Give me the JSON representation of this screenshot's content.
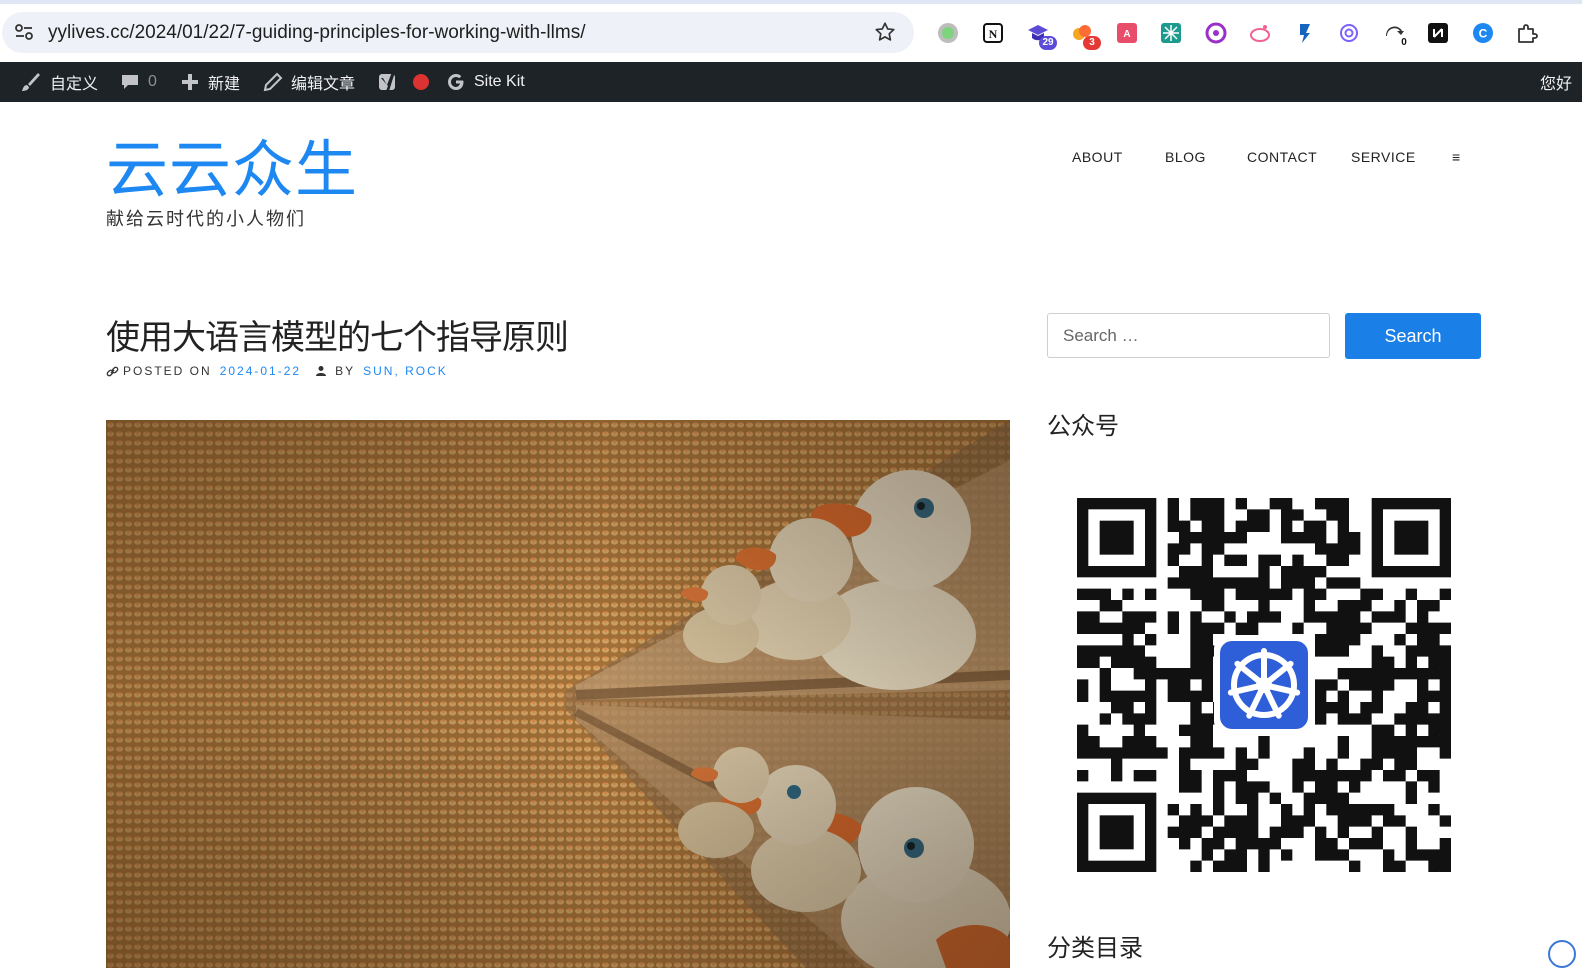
{
  "browser": {
    "url": "yylives.cc/2024/01/22/7-guiding-principles-for-working-with-llms/",
    "extensions": [
      {
        "name": "status-dot-extension",
        "badge": ""
      },
      {
        "name": "notion-extension",
        "badge": ""
      },
      {
        "name": "graduation-cap-extension",
        "badge": "29"
      },
      {
        "name": "cloud-extension",
        "badge": "3"
      },
      {
        "name": "translate-extension",
        "badge": ""
      },
      {
        "name": "grid-extension",
        "badge": ""
      },
      {
        "name": "purple-circle-extension",
        "badge": ""
      },
      {
        "name": "weibo-extension",
        "badge": ""
      },
      {
        "name": "blue-arrow-extension",
        "badge": ""
      },
      {
        "name": "openai-extension",
        "badge": ""
      },
      {
        "name": "cursor-extension",
        "badge": "0"
      },
      {
        "name": "dark-square-extension",
        "badge": ""
      },
      {
        "name": "blue-c-extension",
        "badge": ""
      },
      {
        "name": "puzzle-extension",
        "badge": ""
      }
    ]
  },
  "admin_bar": {
    "customize": "自定义",
    "comments_count": "0",
    "new": "新建",
    "edit_post": "编辑文章",
    "site_kit": "Site Kit",
    "greeting": "您好"
  },
  "site": {
    "title": "云云众生",
    "tagline": "献给云时代的小人物们"
  },
  "nav": {
    "items": [
      "ABOUT",
      "BLOG",
      "CONTACT",
      "SERVICE"
    ],
    "menu_symbol": "≡"
  },
  "post": {
    "title": "使用大语言模型的七个指导原则",
    "posted_on_label": "POSTED ON",
    "date": "2024-01-22",
    "by_label": "BY",
    "authors": "SUN, ROCK"
  },
  "sidebar": {
    "search_placeholder": "Search …",
    "search_button": "Search",
    "wechat_title": "公众号",
    "categories_title": "分类目录"
  },
  "colors": {
    "accent": "#1e88f2",
    "admin_bar": "#1d2327",
    "search_button": "#1a7fe6"
  }
}
